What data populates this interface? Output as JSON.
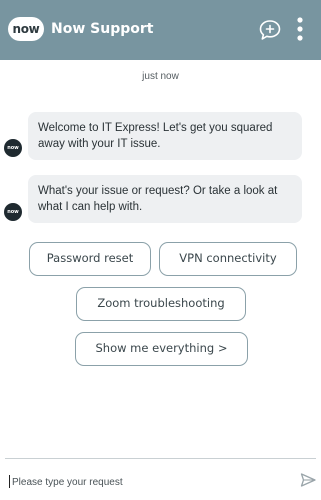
{
  "header": {
    "logo_text": "now",
    "title": "Now Support",
    "icons": {
      "new_chat": "new-chat-icon",
      "menu": "kebab-menu-icon"
    },
    "background_color": "#7895a0"
  },
  "conversation": {
    "timestamp": "just now",
    "messages": [
      {
        "sender_avatar": "now",
        "text": "Welcome to IT Express! Let's get you squared away with your IT issue."
      },
      {
        "sender_avatar": "now",
        "text": "What's your issue or request? Or take a look at what I can help with."
      }
    ],
    "quick_replies": [
      "Password reset",
      "VPN connectivity",
      "Zoom troubleshooting",
      "Show me everything >"
    ]
  },
  "composer": {
    "placeholder": "Please type your request",
    "value": "",
    "send_icon": "send-icon"
  }
}
